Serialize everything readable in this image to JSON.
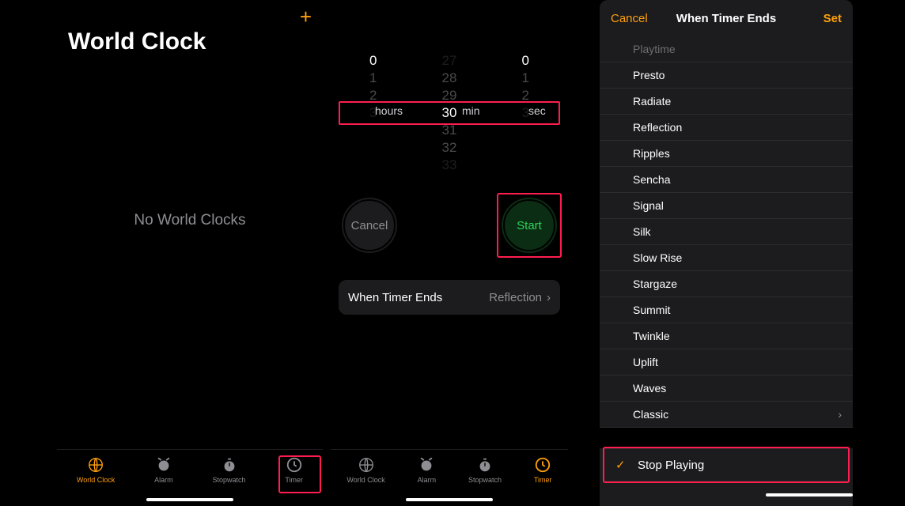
{
  "screen1": {
    "title": "World Clock",
    "empty": "No World Clocks",
    "plus": "+"
  },
  "tabs": {
    "world": "World Clock",
    "alarm": "Alarm",
    "stopwatch": "Stopwatch",
    "timer": "Timer"
  },
  "screen2": {
    "picker": {
      "hours_above": [
        "",
        "",
        ""
      ],
      "hours_sel": "0",
      "hours_below": [
        "1",
        "2",
        "3"
      ],
      "min_above": [
        "27",
        "28",
        "29"
      ],
      "min_sel": "30",
      "min_below": [
        "31",
        "32",
        "33"
      ],
      "sec_above": [
        "",
        "",
        ""
      ],
      "sec_sel": "0",
      "sec_below": [
        "1",
        "2",
        "3"
      ],
      "lbl_hours": "hours",
      "lbl_min": "min",
      "lbl_sec": "sec"
    },
    "cancel": "Cancel",
    "start": "Start",
    "whenends_label": "When Timer Ends",
    "whenends_value": "Reflection"
  },
  "screen3": {
    "cancel": "Cancel",
    "title": "When Timer Ends",
    "set": "Set",
    "items": [
      "Playtime",
      "Presto",
      "Radiate",
      "Reflection",
      "Ripples",
      "Sencha",
      "Signal",
      "Silk",
      "Slow Rise",
      "Stargaze",
      "Summit",
      "Twinkle",
      "Uplift",
      "Waves",
      "Classic"
    ],
    "stop": "Stop Playing"
  }
}
